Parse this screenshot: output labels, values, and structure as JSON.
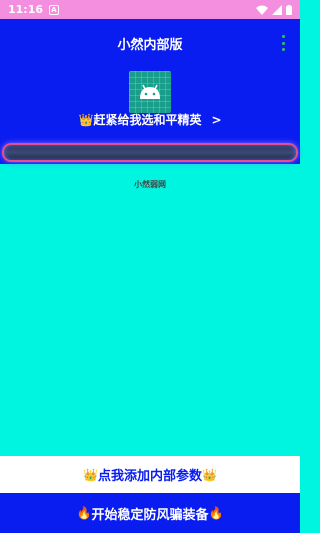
{
  "status_bar": {
    "time": "11:16",
    "notification_icon": "A",
    "icons": [
      "wifi-icon",
      "signal-icon",
      "battery-icon"
    ]
  },
  "app_bar": {
    "title": "小然内部版",
    "overflow_icon": "more-vert-icon",
    "app_icon": "android-icon"
  },
  "promo": {
    "prefix_icon": "👑",
    "label": "赶紧给我选和平精英",
    "chevron": ">"
  },
  "content": {
    "label": "小然弱网"
  },
  "actions": {
    "add_params_label": "点我添加内部参数",
    "add_params_icon": "👑",
    "start_label": "开始稳定防风骗装备",
    "start_icon": "🔥"
  },
  "colors": {
    "status_bar": "#f48fe0",
    "primary": "#0a1df0",
    "content_bg": "#00f5e0",
    "glow_border": "#e0508a"
  }
}
